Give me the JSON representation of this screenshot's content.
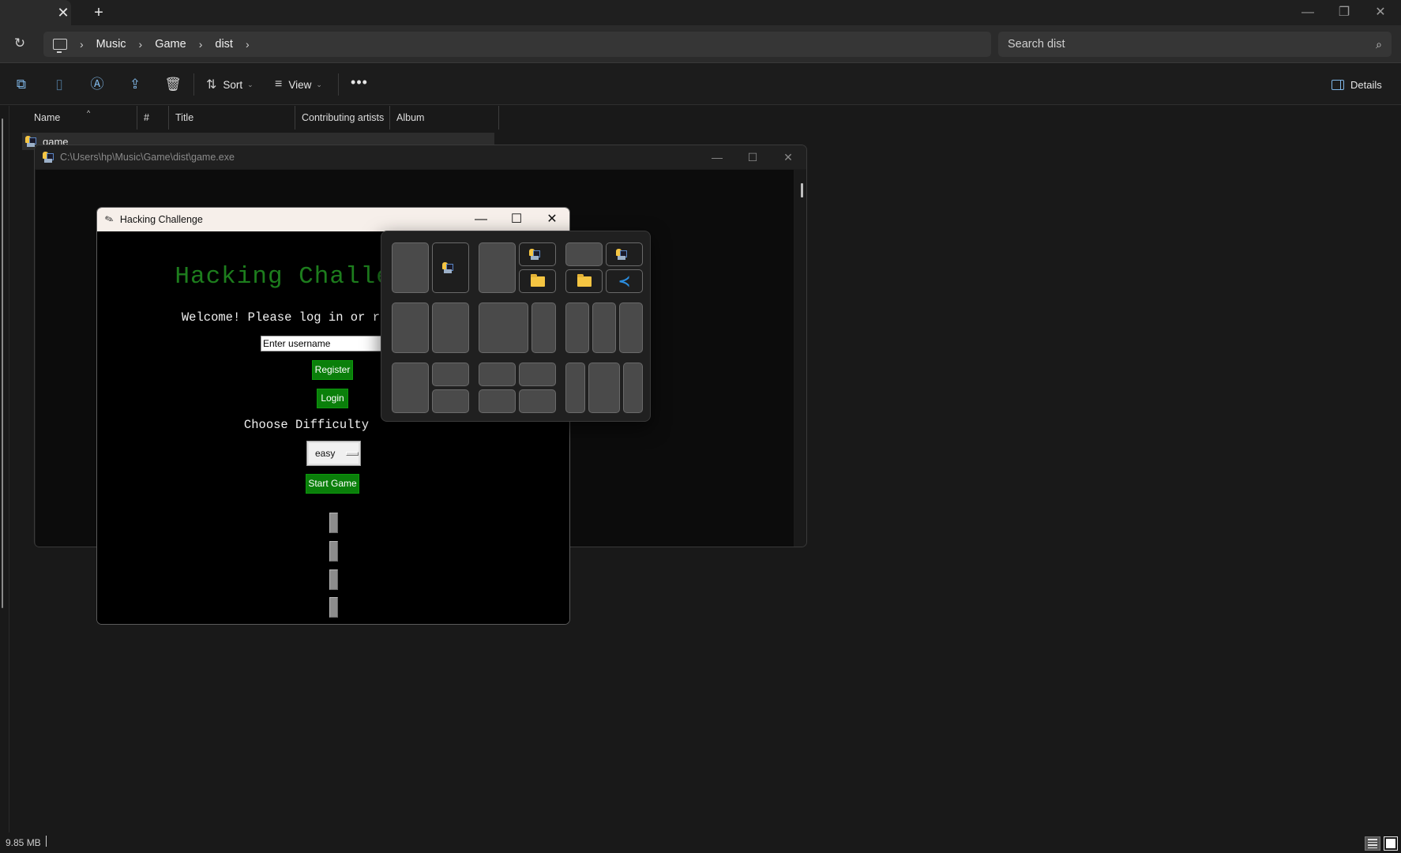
{
  "explorer": {
    "tab": {
      "close_icon": "✕",
      "new_tab_icon": "+"
    },
    "window_controls": {
      "minimize": "—",
      "restore": "❐",
      "close": "✕"
    },
    "address": {
      "refresh_icon": "↻",
      "breadcrumb": [
        "Music",
        "Game",
        "dist"
      ],
      "separator": "›"
    },
    "search": {
      "placeholder": "Search dist",
      "icon": "⌕"
    },
    "toolbar": {
      "sort_label": "Sort",
      "view_label": "View",
      "more_label": "•••",
      "details_label": "Details"
    },
    "columns": [
      "Name",
      "#",
      "Title",
      "Contributing artists",
      "Album"
    ],
    "files": [
      {
        "name": "game"
      }
    ],
    "status": {
      "size": "9.85 MB"
    }
  },
  "console_window": {
    "title": "C:\\Users\\hp\\Music\\Game\\dist\\game.exe",
    "controls": {
      "minimize": "—",
      "maximize": "☐",
      "close": "✕"
    }
  },
  "hack_window": {
    "title": "Hacking Challenge",
    "controls": {
      "minimize": "—",
      "maximize": "☐",
      "close": "✕"
    },
    "heading": "Hacking Challenge",
    "welcome": "Welcome! Please log in or register",
    "username_placeholder": "Enter username",
    "register_label": "Register",
    "login_label": "Login",
    "difficulty_label": "Choose Difficulty",
    "difficulty_value": "easy",
    "start_label": "Start Game"
  },
  "snap_layouts": {
    "apps": [
      "game.exe",
      "game.exe",
      "game.exe",
      "File Explorer",
      "File Explorer",
      "Visual Studio Code"
    ]
  },
  "colors": {
    "heading_green": "#1d7d1d",
    "button_green": "#0a7f0a",
    "accent_blue": "#7fb6e6"
  }
}
